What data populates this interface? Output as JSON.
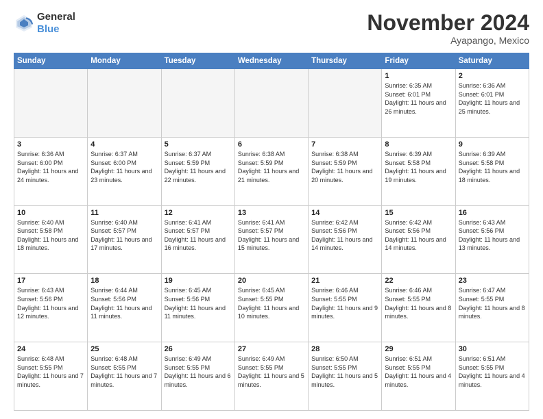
{
  "header": {
    "logo_line1": "General",
    "logo_line2": "Blue",
    "month": "November 2024",
    "location": "Ayapango, Mexico"
  },
  "days_of_week": [
    "Sunday",
    "Monday",
    "Tuesday",
    "Wednesday",
    "Thursday",
    "Friday",
    "Saturday"
  ],
  "weeks": [
    [
      {
        "day": "",
        "info": ""
      },
      {
        "day": "",
        "info": ""
      },
      {
        "day": "",
        "info": ""
      },
      {
        "day": "",
        "info": ""
      },
      {
        "day": "",
        "info": ""
      },
      {
        "day": "1",
        "info": "Sunrise: 6:35 AM\nSunset: 6:01 PM\nDaylight: 11 hours and 26 minutes."
      },
      {
        "day": "2",
        "info": "Sunrise: 6:36 AM\nSunset: 6:01 PM\nDaylight: 11 hours and 25 minutes."
      }
    ],
    [
      {
        "day": "3",
        "info": "Sunrise: 6:36 AM\nSunset: 6:00 PM\nDaylight: 11 hours and 24 minutes."
      },
      {
        "day": "4",
        "info": "Sunrise: 6:37 AM\nSunset: 6:00 PM\nDaylight: 11 hours and 23 minutes."
      },
      {
        "day": "5",
        "info": "Sunrise: 6:37 AM\nSunset: 5:59 PM\nDaylight: 11 hours and 22 minutes."
      },
      {
        "day": "6",
        "info": "Sunrise: 6:38 AM\nSunset: 5:59 PM\nDaylight: 11 hours and 21 minutes."
      },
      {
        "day": "7",
        "info": "Sunrise: 6:38 AM\nSunset: 5:59 PM\nDaylight: 11 hours and 20 minutes."
      },
      {
        "day": "8",
        "info": "Sunrise: 6:39 AM\nSunset: 5:58 PM\nDaylight: 11 hours and 19 minutes."
      },
      {
        "day": "9",
        "info": "Sunrise: 6:39 AM\nSunset: 5:58 PM\nDaylight: 11 hours and 18 minutes."
      }
    ],
    [
      {
        "day": "10",
        "info": "Sunrise: 6:40 AM\nSunset: 5:58 PM\nDaylight: 11 hours and 18 minutes."
      },
      {
        "day": "11",
        "info": "Sunrise: 6:40 AM\nSunset: 5:57 PM\nDaylight: 11 hours and 17 minutes."
      },
      {
        "day": "12",
        "info": "Sunrise: 6:41 AM\nSunset: 5:57 PM\nDaylight: 11 hours and 16 minutes."
      },
      {
        "day": "13",
        "info": "Sunrise: 6:41 AM\nSunset: 5:57 PM\nDaylight: 11 hours and 15 minutes."
      },
      {
        "day": "14",
        "info": "Sunrise: 6:42 AM\nSunset: 5:56 PM\nDaylight: 11 hours and 14 minutes."
      },
      {
        "day": "15",
        "info": "Sunrise: 6:42 AM\nSunset: 5:56 PM\nDaylight: 11 hours and 14 minutes."
      },
      {
        "day": "16",
        "info": "Sunrise: 6:43 AM\nSunset: 5:56 PM\nDaylight: 11 hours and 13 minutes."
      }
    ],
    [
      {
        "day": "17",
        "info": "Sunrise: 6:43 AM\nSunset: 5:56 PM\nDaylight: 11 hours and 12 minutes."
      },
      {
        "day": "18",
        "info": "Sunrise: 6:44 AM\nSunset: 5:56 PM\nDaylight: 11 hours and 11 minutes."
      },
      {
        "day": "19",
        "info": "Sunrise: 6:45 AM\nSunset: 5:56 PM\nDaylight: 11 hours and 11 minutes."
      },
      {
        "day": "20",
        "info": "Sunrise: 6:45 AM\nSunset: 5:55 PM\nDaylight: 11 hours and 10 minutes."
      },
      {
        "day": "21",
        "info": "Sunrise: 6:46 AM\nSunset: 5:55 PM\nDaylight: 11 hours and 9 minutes."
      },
      {
        "day": "22",
        "info": "Sunrise: 6:46 AM\nSunset: 5:55 PM\nDaylight: 11 hours and 8 minutes."
      },
      {
        "day": "23",
        "info": "Sunrise: 6:47 AM\nSunset: 5:55 PM\nDaylight: 11 hours and 8 minutes."
      }
    ],
    [
      {
        "day": "24",
        "info": "Sunrise: 6:48 AM\nSunset: 5:55 PM\nDaylight: 11 hours and 7 minutes."
      },
      {
        "day": "25",
        "info": "Sunrise: 6:48 AM\nSunset: 5:55 PM\nDaylight: 11 hours and 7 minutes."
      },
      {
        "day": "26",
        "info": "Sunrise: 6:49 AM\nSunset: 5:55 PM\nDaylight: 11 hours and 6 minutes."
      },
      {
        "day": "27",
        "info": "Sunrise: 6:49 AM\nSunset: 5:55 PM\nDaylight: 11 hours and 5 minutes."
      },
      {
        "day": "28",
        "info": "Sunrise: 6:50 AM\nSunset: 5:55 PM\nDaylight: 11 hours and 5 minutes."
      },
      {
        "day": "29",
        "info": "Sunrise: 6:51 AM\nSunset: 5:55 PM\nDaylight: 11 hours and 4 minutes."
      },
      {
        "day": "30",
        "info": "Sunrise: 6:51 AM\nSunset: 5:55 PM\nDaylight: 11 hours and 4 minutes."
      }
    ]
  ]
}
